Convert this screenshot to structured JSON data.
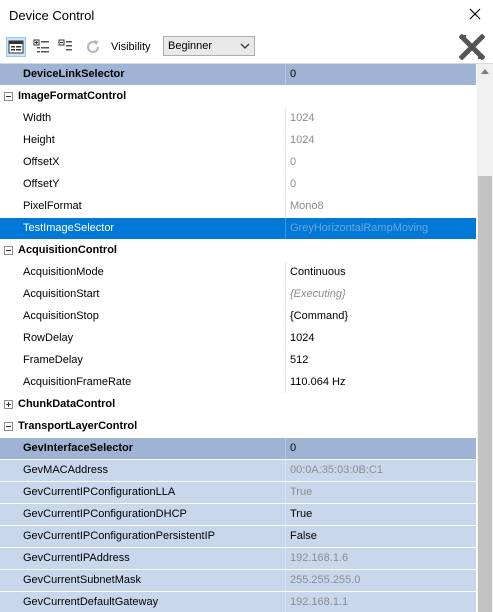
{
  "window": {
    "title": "Device Control"
  },
  "toolbar": {
    "visibility_label": "Visibility",
    "visibility_value": "Beginner"
  },
  "rows": [
    {
      "type": "hdr",
      "name": "DeviceLinkSelector",
      "value": "0"
    },
    {
      "type": "cat",
      "name": "ImageFormatControl",
      "expanded": true
    },
    {
      "type": "param",
      "name": "Width",
      "value": "1024",
      "style": "gray"
    },
    {
      "type": "param",
      "name": "Height",
      "value": "1024",
      "style": "gray"
    },
    {
      "type": "param",
      "name": "OffsetX",
      "value": "0",
      "style": "gray"
    },
    {
      "type": "param",
      "name": "OffsetY",
      "value": "0",
      "style": "gray"
    },
    {
      "type": "param",
      "name": "PixelFormat",
      "value": "Mono8",
      "style": "gray"
    },
    {
      "type": "sel",
      "name": "TestImageSelector",
      "value": "GreyHorizontalRampMoving"
    },
    {
      "type": "cat",
      "name": "AcquisitionControl",
      "expanded": true
    },
    {
      "type": "param",
      "name": "AcquisitionMode",
      "value": "Continuous",
      "style": "normal"
    },
    {
      "type": "param",
      "name": "AcquisitionStart",
      "value": "{Executing}",
      "style": "italic-gray"
    },
    {
      "type": "param",
      "name": "AcquisitionStop",
      "value": "{Command}",
      "style": "normal"
    },
    {
      "type": "param",
      "name": "RowDelay",
      "value": "1024",
      "style": "normal"
    },
    {
      "type": "param",
      "name": "FrameDelay",
      "value": "512",
      "style": "normal"
    },
    {
      "type": "param",
      "name": "AcquisitionFrameRate",
      "value": "110.064 Hz",
      "style": "normal"
    },
    {
      "type": "cat",
      "name": "ChunkDataControl",
      "expanded": false
    },
    {
      "type": "cat",
      "name": "TransportLayerControl",
      "expanded": true
    },
    {
      "type": "hdr",
      "name": "GevInterfaceSelector",
      "value": "0"
    },
    {
      "type": "tl",
      "name": "GevMACAddress",
      "value": "00:0A:35:03:0B:C1",
      "style": "gray"
    },
    {
      "type": "tl",
      "name": "GevCurrentIPConfigurationLLA",
      "value": "True",
      "style": "gray"
    },
    {
      "type": "tl",
      "name": "GevCurrentIPConfigurationDHCP",
      "value": "True",
      "style": "normal"
    },
    {
      "type": "tl",
      "name": "GevCurrentIPConfigurationPersistentIP",
      "value": "False",
      "style": "normal"
    },
    {
      "type": "tl",
      "name": "GevCurrentIPAddress",
      "value": "192.168.1.6",
      "style": "gray"
    },
    {
      "type": "tl",
      "name": "GevCurrentSubnetMask",
      "value": "255.255.255.0",
      "style": "gray"
    },
    {
      "type": "tl",
      "name": "GevCurrentDefaultGateway",
      "value": "192.168.1.1",
      "style": "gray"
    }
  ]
}
